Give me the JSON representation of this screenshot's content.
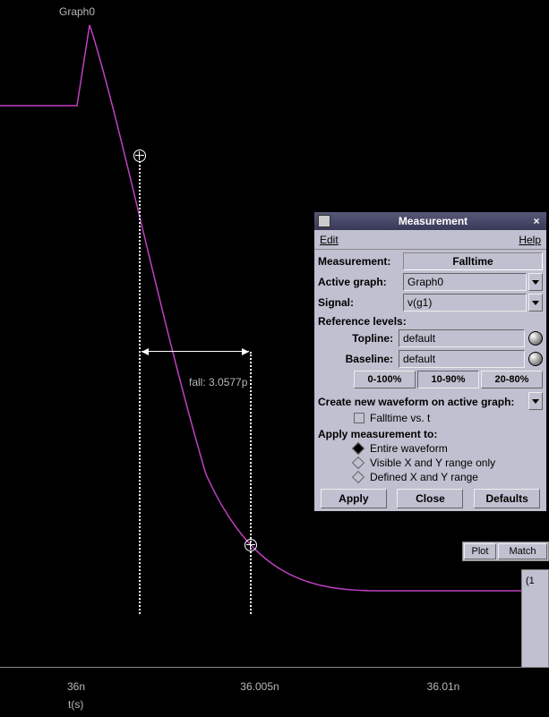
{
  "graph": {
    "label": "Graph0",
    "fall_annotation": "fall: 3.0577p",
    "xaxis_label": "t(s)",
    "ticks": [
      "36n",
      "36.005n",
      "36.01n"
    ]
  },
  "dialog": {
    "title": "Measurement",
    "menu": {
      "edit": "Edit",
      "help": "Help"
    },
    "measurement_label": "Measurement:",
    "measurement_value": "Falltime",
    "active_graph_label": "Active graph:",
    "active_graph_value": "Graph0",
    "signal_label": "Signal:",
    "signal_value": "v(g1)",
    "ref_levels_label": "Reference levels:",
    "topline_label": "Topline:",
    "topline_value": "default",
    "baseline_label": "Baseline:",
    "baseline_value": "default",
    "pct_btns": [
      "0-100%",
      "10-90%",
      "20-80%"
    ],
    "pct_active": 1,
    "create_wf_label": "Create new waveform on active graph:",
    "falltime_vs_t": "Falltime vs. t",
    "apply_to_label": "Apply measurement to:",
    "radios": [
      "Entire waveform",
      "Visible X and Y range only",
      "Defined X and Y range"
    ],
    "radio_selected": 0,
    "buttons": {
      "apply": "Apply",
      "close": "Close",
      "defaults": "Defaults"
    }
  },
  "bg": {
    "plot_btn": "Plot",
    "match_btn": "Match",
    "coord": "(1"
  }
}
